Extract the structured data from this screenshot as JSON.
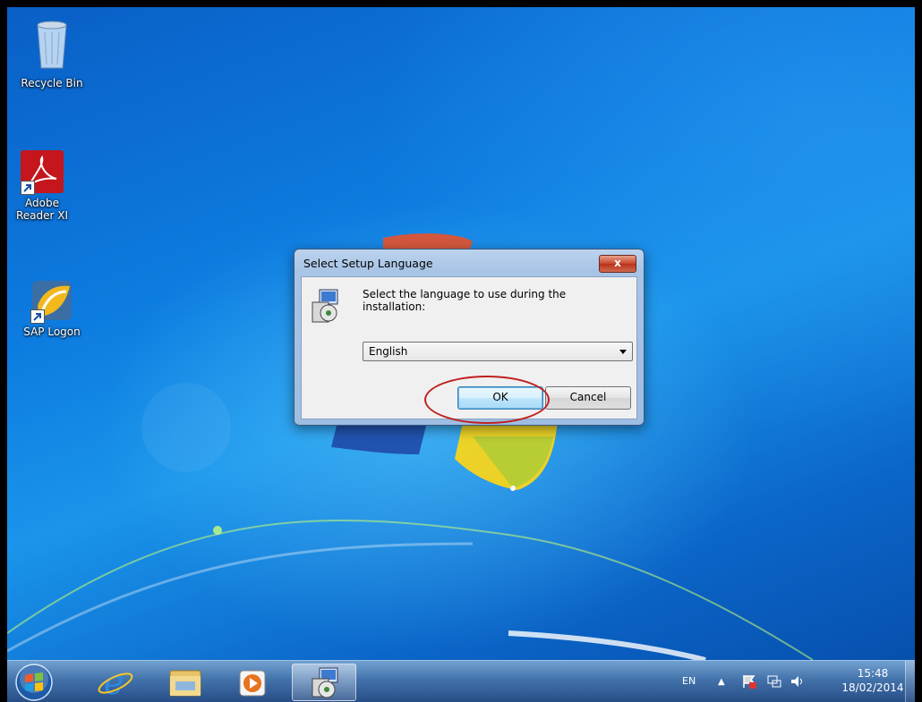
{
  "desktop": {
    "icons": [
      {
        "label": "Recycle Bin"
      },
      {
        "label": "Adobe Reader XI"
      },
      {
        "label": "SAP Logon"
      }
    ]
  },
  "dialog": {
    "title": "Select Setup Language",
    "close_label": "x",
    "message": "Select the language to use during the installation:",
    "language_selected": "English",
    "ok_label": "OK",
    "cancel_label": "Cancel"
  },
  "taskbar": {
    "language": "EN",
    "time": "15:48",
    "date": "18/02/2014",
    "pinned": [
      "start-orb",
      "internet-explorer",
      "windows-explorer",
      "media-player",
      "setup-installer"
    ]
  },
  "colors": {
    "highlight": "#c02020",
    "desktop_blue": "#0d7ce0"
  }
}
